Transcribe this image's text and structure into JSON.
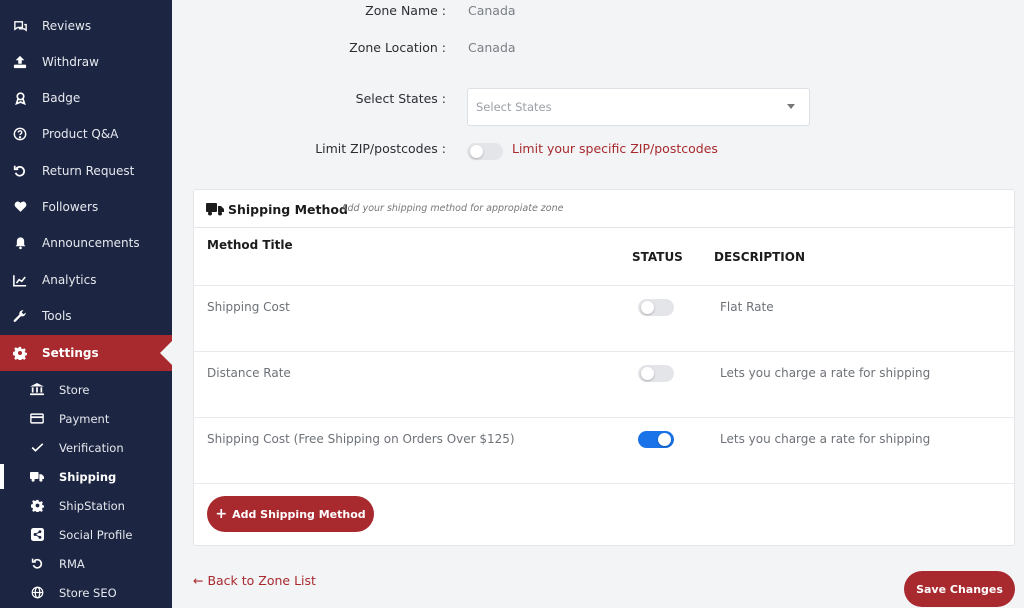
{
  "sidebar": {
    "items": [
      {
        "label": "Reviews",
        "icon": "reviews-icon"
      },
      {
        "label": "Withdraw",
        "icon": "withdraw-icon"
      },
      {
        "label": "Badge",
        "icon": "badge-icon"
      },
      {
        "label": "Product Q&A",
        "icon": "question-icon"
      },
      {
        "label": "Return Request",
        "icon": "return-icon"
      },
      {
        "label": "Followers",
        "icon": "heart-icon"
      },
      {
        "label": "Announcements",
        "icon": "bell-icon"
      },
      {
        "label": "Analytics",
        "icon": "chart-icon"
      },
      {
        "label": "Tools",
        "icon": "wrench-icon"
      },
      {
        "label": "Settings",
        "icon": "gear-icon"
      }
    ],
    "sub_items": [
      {
        "label": "Store",
        "icon": "bank-icon"
      },
      {
        "label": "Payment",
        "icon": "credit-card-icon"
      },
      {
        "label": "Verification",
        "icon": "check-icon"
      },
      {
        "label": "Shipping",
        "icon": "truck-icon"
      },
      {
        "label": "ShipStation",
        "icon": "gear-icon"
      },
      {
        "label": "Social Profile",
        "icon": "share-icon"
      },
      {
        "label": "RMA",
        "icon": "return-icon"
      },
      {
        "label": "Store SEO",
        "icon": "globe-icon"
      }
    ],
    "active_item": "Settings",
    "current_sub_item": "Shipping"
  },
  "form": {
    "zone_name_label": "Zone Name :",
    "zone_name_value": "Canada",
    "zone_location_label": "Zone Location :",
    "zone_location_value": "Canada",
    "states_label": "Select States :",
    "states_placeholder": "Select States",
    "limit_zip_label": "Limit ZIP/postcodes :",
    "limit_zip_text": "Limit your specific ZIP/postcodes",
    "limit_zip_enabled": false
  },
  "shipping_method": {
    "title": "Shipping Method",
    "hint": "Add your shipping method for appropiate zone",
    "columns": {
      "method_title": "Method Title",
      "status": "STATUS",
      "description": "DESCRIPTION"
    },
    "rows": [
      {
        "title": "Shipping Cost",
        "enabled": false,
        "description": "Flat Rate"
      },
      {
        "title": "Distance Rate",
        "enabled": false,
        "description": "Lets you charge a rate for shipping"
      },
      {
        "title": "Shipping Cost (Free Shipping on Orders Over $125)",
        "enabled": true,
        "description": "Lets you charge a rate for shipping"
      }
    ],
    "add_button": "Add Shipping Method"
  },
  "footer": {
    "back_link": "← Back to Zone List",
    "save_button": "Save Changes"
  },
  "colors": {
    "sidebar_bg": "#1c2541",
    "accent": "#a82a2f",
    "toggle_on": "#1a73e8",
    "toggle_off": "#e3e5e8"
  }
}
